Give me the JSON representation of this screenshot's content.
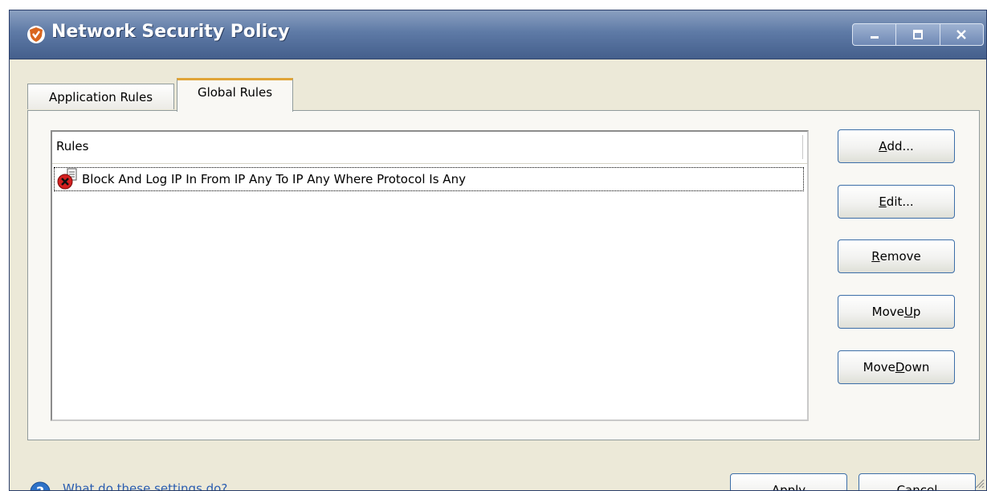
{
  "window": {
    "title": "Network Security Policy",
    "controls": [
      "minimize-icon",
      "maximize-icon",
      "close-icon"
    ]
  },
  "tabs": [
    {
      "label": "Application Rules",
      "active": false
    },
    {
      "label": "Global Rules",
      "active": true
    }
  ],
  "rules_list": {
    "header": "Rules",
    "rows": [
      {
        "icon": "block-rule-icon",
        "text": "Block And Log IP In From IP Any To IP Any Where Protocol Is Any"
      }
    ]
  },
  "side_buttons": {
    "add": {
      "before": "",
      "mnemonic": "A",
      "after": "dd..."
    },
    "edit": {
      "before": "",
      "mnemonic": "E",
      "after": "dit..."
    },
    "remove": {
      "before": "",
      "mnemonic": "R",
      "after": "emove"
    },
    "move_up": {
      "before": "Move ",
      "mnemonic": "U",
      "after": "p"
    },
    "move_down": {
      "before": "Move ",
      "mnemonic": "D",
      "after": "own"
    }
  },
  "footer": {
    "help_link": "What do these settings do?",
    "apply": "Apply",
    "cancel": "Cancel"
  },
  "colors": {
    "titlebar": "#5e7aa6",
    "dialog_bg": "#ece9d8",
    "active_tab_accent": "#e0a437",
    "button_border": "#3c6ea8",
    "link": "#2a5db0"
  }
}
